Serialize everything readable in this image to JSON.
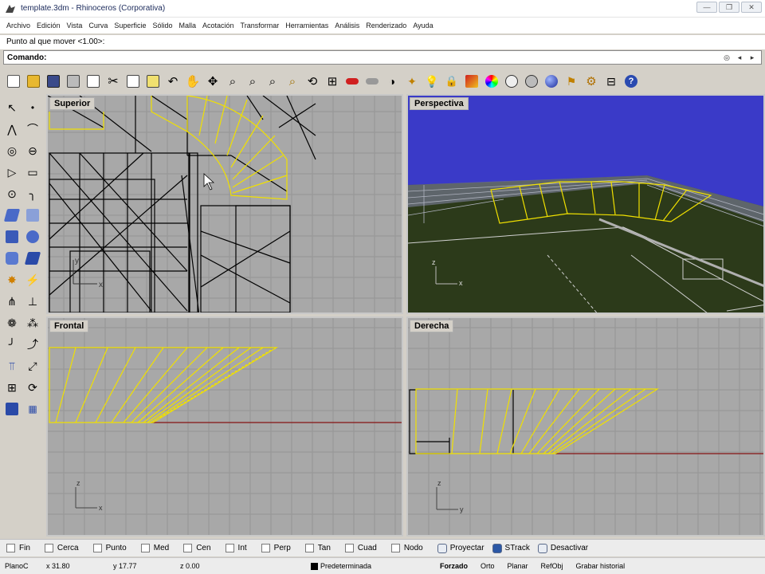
{
  "window": {
    "title": "template.3dm - Rhinoceros (Corporativa)",
    "buttons": [
      "—",
      "❐",
      "✕"
    ]
  },
  "menu": [
    "Archivo",
    "Edición",
    "Vista",
    "Curva",
    "Superficie",
    "Sólido",
    "Malla",
    "Acotación",
    "Transformar",
    "Herramientas",
    "Análisis",
    "Renderizado",
    "Ayuda"
  ],
  "command": {
    "history": "Punto al que mover <1.00>:",
    "prompt_label": "Comando:",
    "input_value": ""
  },
  "toolbar_icons": [
    "new-file-icon",
    "open-icon",
    "save-icon",
    "print-icon",
    "template-icon",
    "cut-icon",
    "copy-icon",
    "paste-icon",
    "undo-icon",
    "pan-hand-icon",
    "move-view-icon",
    "zoom-icon",
    "zoom-window-icon",
    "zoom-extents-icon",
    "zoom-selected-icon",
    "rotate-view-icon",
    "four-views-icon",
    "car-icon",
    "hide-icon",
    "show-icon",
    "select-icon",
    "light-bulb-icon",
    "lock-icon",
    "layers-icon",
    "color-wheel-icon",
    "sphere-wire-icon",
    "sphere-shaded-icon",
    "sphere-render-icon",
    "flag-icon",
    "gear-icon",
    "grid-tools-icon",
    "help-icon"
  ],
  "viewports": {
    "top": {
      "label": "Superior"
    },
    "perspective": {
      "label": "Perspectiva"
    },
    "front": {
      "label": "Frontal"
    },
    "right": {
      "label": "Derecha"
    }
  },
  "axes": {
    "top": {
      "y": "y",
      "x": "x"
    },
    "perspective": {
      "z": "z",
      "x": "x"
    },
    "front": {
      "z": "z",
      "x": "x"
    },
    "right": {
      "z": "z",
      "y": "y"
    }
  },
  "osnaps": [
    "Fin",
    "Cerca",
    "Punto",
    "Med",
    "Cen",
    "Int",
    "Perp",
    "Tan",
    "Cuad",
    "Nodo"
  ],
  "toggles": [
    {
      "label": "Proyectar",
      "on": false
    },
    {
      "label": "STrack",
      "on": true
    },
    {
      "label": "Desactivar",
      "on": false
    }
  ],
  "status": {
    "plane": "PlanoC",
    "x": "x 31.80",
    "y": "y 17.77",
    "z": "z 0.00",
    "layer": "Predeterminada",
    "buttons": [
      "Forzado",
      "Orto",
      "Planar",
      "RefObj",
      "Grabar historial"
    ]
  },
  "colors": {
    "viewport_bg": "#a8a8a8",
    "grid": "#959595",
    "wire": "#000000",
    "selected": "#f0e000",
    "sky": "#3a3ac8",
    "grass": "#2c3a1a",
    "xaxis": "#8a2a2a"
  }
}
